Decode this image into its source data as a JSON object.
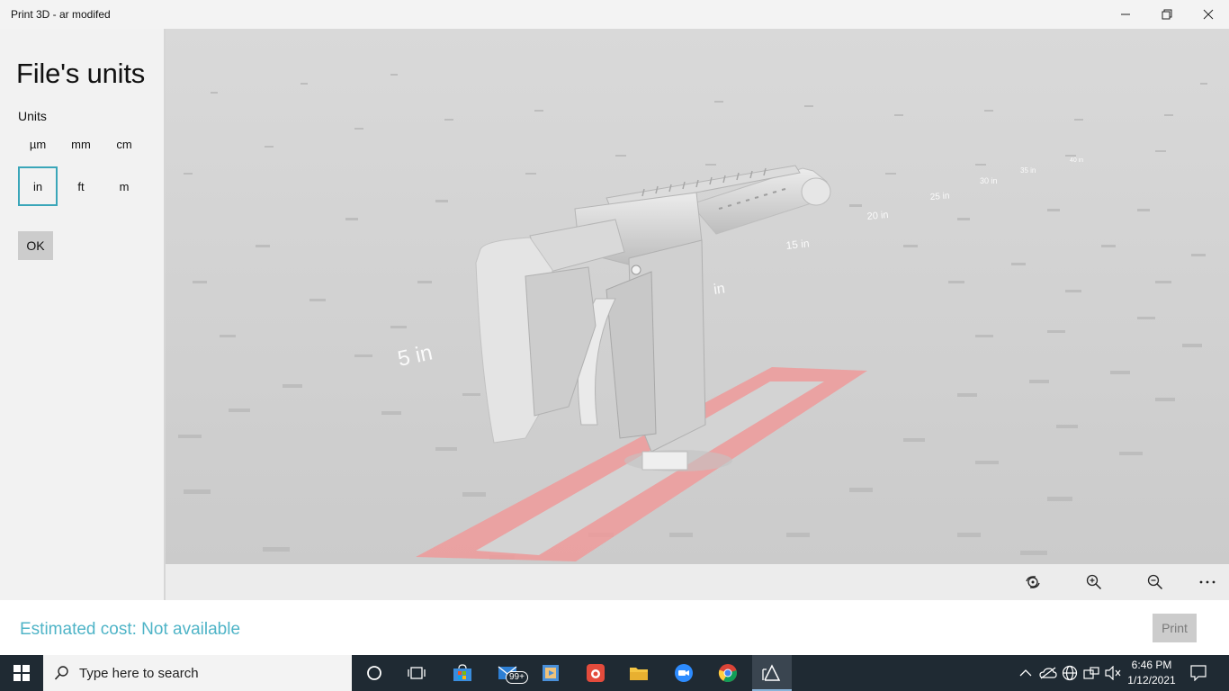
{
  "window": {
    "title": "Print 3D - ar modifed",
    "controls": [
      "minimize-icon",
      "restore-icon",
      "close-icon"
    ]
  },
  "panel": {
    "title": "File's units",
    "units_label": "Units",
    "units": [
      "µm",
      "mm",
      "cm",
      "in",
      "ft",
      "m"
    ],
    "selected_unit": "in",
    "ok_label": "OK"
  },
  "viewport": {
    "ruler_labels": [
      "5 in",
      "in",
      "15 in",
      "20 in",
      "25 in",
      "30 in",
      "35 in",
      "40 in"
    ],
    "colors": {
      "floor": "#cfcfcf",
      "model": "#e2e2e2",
      "bed_outline": "#f08080"
    }
  },
  "view_toolbar": {
    "buttons": [
      "camera-reset-icon",
      "zoom-in-icon",
      "zoom-out-icon",
      "more-icon"
    ]
  },
  "footer": {
    "cost_text": "Estimated cost: Not available",
    "print_label": "Print",
    "accent": "#4fb4c7"
  },
  "taskbar": {
    "search_placeholder": "Type here to search",
    "mail_badge": "99+",
    "time": "6:46 PM",
    "date": "1/12/2021",
    "apps": [
      "cortana-icon",
      "task-view-icon",
      "store-icon",
      "mail-icon",
      "video-icon",
      "camera-app-icon",
      "file-explorer-icon",
      "zoom-icon",
      "chrome-icon",
      "print3d-icon"
    ],
    "tray": [
      "chevron-up-icon",
      "onedrive-icon",
      "network-icon",
      "keyboard-icon",
      "volume-mute-icon",
      "notification-icon"
    ]
  }
}
